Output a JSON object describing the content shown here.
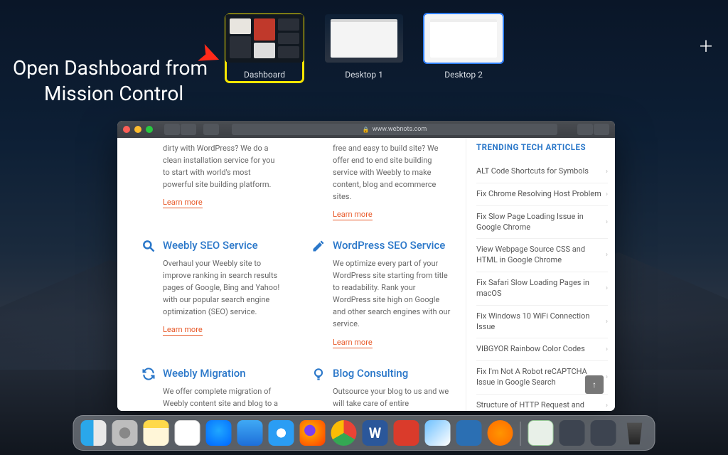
{
  "annotation": {
    "line1": "Open Dashboard from",
    "line2": "Mission Control"
  },
  "spaces": {
    "dashboard": "Dashboard",
    "desktop1": "Desktop 1",
    "desktop2": "Desktop 2"
  },
  "browser": {
    "url": "www.webnots.com",
    "intro_left": "dirty with WordPress? We do a clean installation service for you to start with world's most powerful site building platform.",
    "intro_right": "free and easy to build site? We offer end to end site building service with Weebly to make content, blog and ecommerce sites.",
    "learn": "Learn more",
    "services": {
      "weebly_seo": {
        "title": "Weebly SEO Service",
        "body": "Overhaul your Weebly site to improve ranking in search results pages of Google, Bing and Yahoo! with our popular search engine optimization (SEO) service."
      },
      "wp_seo": {
        "title": "WordPress SEO Service",
        "body": "We optimize every part of your WordPress site starting from title to readability. Rank your WordPress site high on Google and other search engines with our service."
      },
      "weebly_mig": {
        "title": "Weebly Migration",
        "body": "We offer complete migration of Weebly content site and blog to a fresh looking self-hosted"
      },
      "blog_consult": {
        "title": "Blog Consulting",
        "body": "Outsource your blog to us and we will take care of entire maintenance, backup, publishing"
      }
    },
    "sidebar": {
      "title": "TRENDING TECH ARTICLES",
      "items": [
        "ALT Code Shortcuts for Symbols",
        "Fix Chrome Resolving Host Problem",
        "Fix Slow Page Loading Issue in Google Chrome",
        "View Webpage Source CSS and HTML in Google Chrome",
        "Fix Safari Slow Loading Pages in macOS",
        "Fix Windows 10 WiFi Connection Issue",
        "VIBGYOR Rainbow Color Codes",
        "Fix I'm Not A Robot reCAPTCHA Issue in Google Search",
        "Structure of HTTP Request and"
      ]
    }
  },
  "dock": {
    "apps": [
      "Finder",
      "Launchpad",
      "Notes",
      "Reminders",
      "App Store",
      "Mail",
      "Safari",
      "Firefox",
      "Chrome",
      "Word",
      "ExpressVPN",
      "Preview",
      "Snagit",
      "Books"
    ],
    "right": [
      "Document",
      "Folder1",
      "Folder2",
      "Trash"
    ]
  }
}
